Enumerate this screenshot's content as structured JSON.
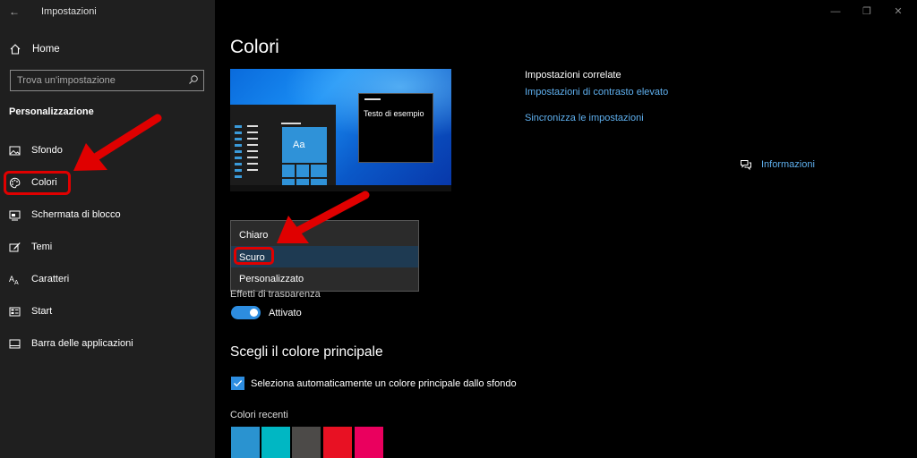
{
  "window": {
    "title": "Impostazioni",
    "controls": [
      "minimize",
      "restore",
      "close"
    ]
  },
  "sidebar": {
    "home_label": "Home",
    "search_placeholder": "Trova un'impostazione",
    "section_title": "Personalizzazione",
    "items": [
      {
        "label": "Sfondo",
        "icon": "picture-icon"
      },
      {
        "label": "Colori",
        "icon": "palette-icon",
        "highlighted": true
      },
      {
        "label": "Schermata di blocco",
        "icon": "lock-screen-icon"
      },
      {
        "label": "Temi",
        "icon": "brush-icon"
      },
      {
        "label": "Caratteri",
        "icon": "font-icon"
      },
      {
        "label": "Start",
        "icon": "start-icon"
      },
      {
        "label": "Barra delle applicazioni",
        "icon": "taskbar-icon"
      }
    ]
  },
  "main": {
    "title": "Colori",
    "preview": {
      "sample_text": "Testo di esempio",
      "tile_text": "Aa"
    },
    "mode_dropdown": {
      "options": [
        "Chiaro",
        "Scuro",
        "Personalizzato"
      ],
      "selected": "Scuro"
    },
    "transparency": {
      "label": "Effetti di trasparenza",
      "state_label": "Attivato",
      "on": true
    },
    "accent_section_title": "Scegli il colore principale",
    "auto_accent": {
      "label": "Seleziona automaticamente un colore principale dallo sfondo",
      "checked": true
    },
    "recent_colors_label": "Colori recenti",
    "recent_colors": [
      "#2a93d0",
      "#00b7c3",
      "#4c4a48",
      "#e81123",
      "#ea005e"
    ]
  },
  "related": {
    "title": "Impostazioni correlate",
    "links": [
      "Impostazioni di contrasto elevato",
      "Sincronizza le impostazioni"
    ],
    "info_label": "Informazioni"
  },
  "colors": {
    "accent": "#2d8de0",
    "link": "#5fb0ef",
    "annotation_red": "#e00000"
  }
}
